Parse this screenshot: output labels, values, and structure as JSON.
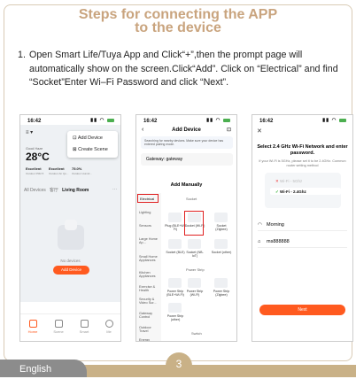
{
  "title_line1": "Steps for connecting the APP",
  "title_line2": "to the device",
  "step_number": "1.",
  "step_text": "Open Smart Life/Tuya App and Click“+”,then the prompt page will automatically show on the screen.Click“Add”. Click on “Electrical” and find “Socket”Enter Wi–Fi Password and click “Next”.",
  "language": "English",
  "page_number": "3",
  "phone1": {
    "time": "16:42",
    "status_icons": "▮▮ ◠ ",
    "temp": "28°C",
    "weather_label": "Good Haze",
    "temp_stats": [
      "Excellent",
      "Excellent",
      "75.0%"
    ],
    "temp_stats_sub": [
      "Outdoor PM2.5",
      "Outdoor Air Qu...",
      "Outdoor Humid..."
    ],
    "menu_add_device": "Add Device",
    "menu_create_scene": "Create Scene",
    "tab_all": "All Devices",
    "tab_2": "客厅",
    "tab_living": "Living Room",
    "tab_more": "···",
    "no_devices": "No devices",
    "add_device_btn": "Add Device",
    "nav": [
      "Home",
      "Scene",
      "Smart",
      "Me"
    ]
  },
  "phone2": {
    "time": "16:42",
    "header": "Add Device",
    "scan_text": "Searching for nearby devices. Make sure your device has entered pairing mode.",
    "gateway": "Gateway: gateway",
    "add_manually": "Add Manually",
    "electrical": "Electrical",
    "socket_head": "Socket",
    "categories": [
      "Lighting",
      "Sensors",
      "Large Home Ap...",
      "Small Home Appliances",
      "Kitchen Appliances",
      "Exercise & Health",
      "Security & Video Sur...",
      "Gateway Control",
      "Outdoor Travel",
      "Energy"
    ],
    "grid_labels": [
      "Plug (BLE+Wi-Fi)",
      "Socket (Wi-Fi)",
      "Socket (Zigbee)",
      "Socket (BLE)",
      "Socket (NB-IoT)",
      "Socket (other)",
      "Power Strip",
      "Power Strip (BLE+Wi-Fi)",
      "Power Strip (Wi-Fi)",
      "Power Strip (Zigbee)",
      "Power Strip (other)",
      "Switch"
    ]
  },
  "phone3": {
    "time": "16:42",
    "heading": "Select 2.4 GHz Wi-Fi Network and enter password.",
    "sub": "If your Wi-Fi is 5GHz, please set it to be 2.4GHz. Common router setting method",
    "wifi_5g": "Wi-Fi - 5Ghz",
    "wifi_24g": "Wi-Fi - 2.4Ghz",
    "ssid": "Morning",
    "password": "ms888888",
    "next": "Next"
  }
}
